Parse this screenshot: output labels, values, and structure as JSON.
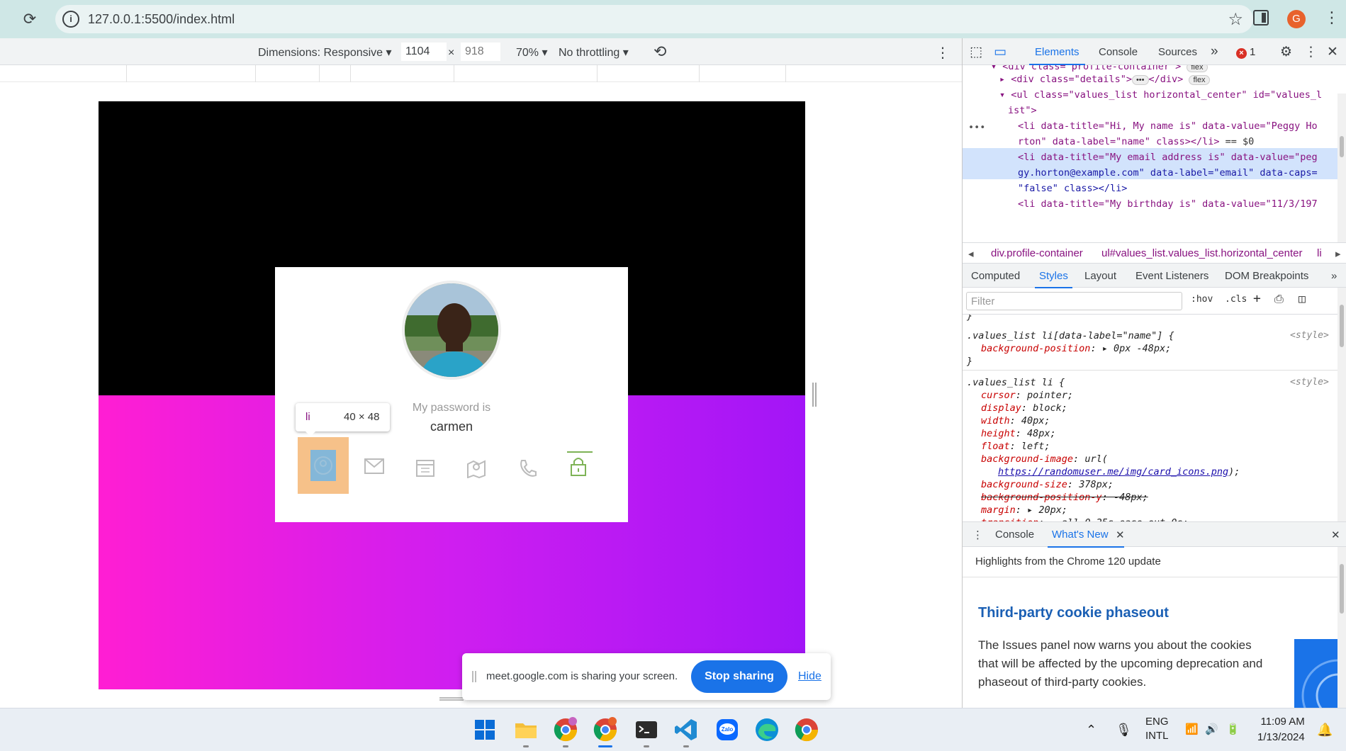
{
  "browser": {
    "url": "127.0.0.1:5500/index.html",
    "profile_initial": "G",
    "icons": [
      "reload-icon",
      "site-info-icon",
      "bookmark-star-icon",
      "side-panel-icon",
      "chrome-menu-icon"
    ]
  },
  "device_toolbar": {
    "dimensions_label": "Dimensions: Responsive",
    "width": "1104",
    "times": "×",
    "height": "918",
    "zoom": "70%",
    "throttling": "No throttling"
  },
  "profile_card": {
    "password_title": "My password is",
    "password_value": "carmen",
    "icons": [
      "user-icon",
      "email-icon",
      "calendar-icon",
      "map-icon",
      "phone-icon",
      "lock-icon"
    ],
    "colors": {
      "highlight_margin": "#f6c189",
      "highlight_content": "#84b7d8",
      "active": "#7eb356",
      "gradient_start": "#ff1ed3",
      "gradient_end": "#a215f7"
    }
  },
  "inspect_tooltip": {
    "tag": "li",
    "size": "40 × 48"
  },
  "screen_share": {
    "message": "meet.google.com is sharing your screen.",
    "stop_label": "Stop sharing",
    "hide_label": "Hide"
  },
  "devtools": {
    "tabs": [
      "Elements",
      "Console",
      "Sources"
    ],
    "error_count": "1",
    "dom_lines": {
      "l1": "<div class=\"profile-container\">",
      "l2a": "<div class=\"details\">",
      "l2b": "</div>",
      "l3a": "<ul class=\"values_list horizontal_center\" id=\"values_l",
      "l3b": "ist\">",
      "l4a": "<li data-title=\"Hi, My name is\" data-value=\"Peggy Ho",
      "l4b": "rton\" data-label=\"name\" class></li>",
      "l4c": "== $0",
      "l5a": "<li data-title=\"My email address is\" data-value=\"peg",
      "l5b": "gy.horton@example.com\" data-label=\"email\" data-caps=",
      "l5c": "\"false\" class></li>",
      "l6": "<li data-title=\"My birthday is\" data-value=\"11/3/197",
      "flex": "flex",
      "dots": "•••"
    },
    "breadcrumbs": [
      "div.profile-container",
      "ul#values_list.values_list.horizontal_center",
      "li"
    ],
    "subtabs": [
      "Computed",
      "Styles",
      "Layout",
      "Event Listeners",
      "DOM Breakpoints"
    ],
    "filter_placeholder": "Filter",
    "filter_buttons": [
      ":hov",
      ".cls",
      "+"
    ],
    "styles": {
      "rule1_selector": ".values_list li[data-label=\"name\"] {",
      "rule1_prop": "background-position",
      "rule1_val": "0px -48px;",
      "source": "<style>",
      "close": "}",
      "rule2_selector": ".values_list li {",
      "props": [
        {
          "p": "cursor",
          "v": "pointer;"
        },
        {
          "p": "display",
          "v": "block;"
        },
        {
          "p": "width",
          "v": "40px;"
        },
        {
          "p": "height",
          "v": "48px;"
        },
        {
          "p": "float",
          "v": "left;"
        },
        {
          "p": "background-image",
          "v": "url("
        },
        {
          "p": "background-size",
          "v": "378px;"
        },
        {
          "p": "background-position-y",
          "v": "-48px;"
        },
        {
          "p": "margin",
          "v": "20px;"
        },
        {
          "p": "transition",
          "v": "all 0.25s ease-out 0s;"
        }
      ],
      "bg_url": "https://randomuser.me/img/card_icons.png",
      "bg_url_close": ");",
      "rule3_selector": "* {"
    },
    "drawer_tabs": [
      "Console",
      "What's New"
    ],
    "whats_new": {
      "highlights": "Highlights from the Chrome 120 update",
      "heading": "Third-party cookie phaseout",
      "body": "The Issues panel now warns you about the cookies that will be affected by the upcoming deprecation and phaseout of third-party cookies."
    }
  },
  "taskbar": {
    "apps": [
      "windows-start-icon",
      "file-explorer-icon",
      "chrome-icon",
      "chrome-profile-icon",
      "terminal-icon",
      "vscode-icon",
      "zalo-icon",
      "edge-icon",
      "chrome-alt-icon"
    ],
    "zalo_label": "Zalo",
    "lang_top": "ENG",
    "lang_bottom": "INTL",
    "time": "11:09 AM",
    "date": "1/13/2024"
  }
}
